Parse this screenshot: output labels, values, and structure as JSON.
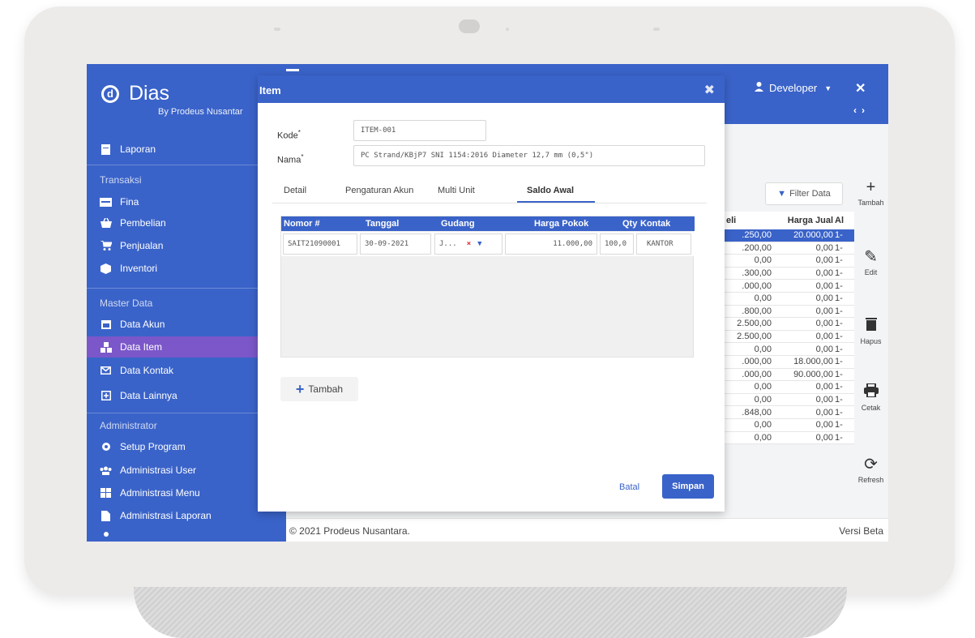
{
  "brand": {
    "name": "Dias",
    "subtitle": "By Prodeus Nusantar"
  },
  "sidebar": {
    "report_item": "Laporan",
    "sections": {
      "transaksi": "Transaksi",
      "master": "Master Data",
      "admin": "Administrator"
    },
    "transaksi_items": [
      "Fina",
      "Pembelian",
      "Penjualan",
      "Inventori"
    ],
    "master_items": [
      "Data Akun",
      "Data Item",
      "Data Kontak",
      "Data Lainnya"
    ],
    "admin_items": [
      "Setup Program",
      "Administrasi User",
      "Administrasi Menu",
      "Administrasi Laporan"
    ],
    "active_item": "Data Item"
  },
  "topbar": {
    "user": "Developer"
  },
  "toolbar": {
    "filter_label": "Filter Data",
    "add": "Tambah",
    "edit": "Edit",
    "delete": "Hapus",
    "print": "Cetak",
    "refresh": "Refresh"
  },
  "background_table": {
    "headers": [
      "eli",
      "Harga Jual",
      "Al"
    ],
    "rows": [
      [
        ".250,00",
        "20.000,00",
        "1-"
      ],
      [
        ".200,00",
        "0,00",
        "1-"
      ],
      [
        "0,00",
        "0,00",
        "1-"
      ],
      [
        ".300,00",
        "0,00",
        "1-"
      ],
      [
        ".000,00",
        "0,00",
        "1-"
      ],
      [
        "0,00",
        "0,00",
        "1-"
      ],
      [
        ".800,00",
        "0,00",
        "1-"
      ],
      [
        "2.500,00",
        "0,00",
        "1-"
      ],
      [
        "2.500,00",
        "0,00",
        "1-"
      ],
      [
        "0,00",
        "0,00",
        "1-"
      ],
      [
        ".000,00",
        "18.000,00",
        "1-"
      ],
      [
        ".000,00",
        "90.000,00",
        "1-"
      ],
      [
        "0,00",
        "0,00",
        "1-"
      ],
      [
        "0,00",
        "0,00",
        "1-"
      ],
      [
        ".848,00",
        "0,00",
        "1-"
      ],
      [
        "0,00",
        "0,00",
        "1-"
      ],
      [
        "0,00",
        "0,00",
        "1-"
      ]
    ]
  },
  "footer": {
    "copyright": "© 2021 Prodeus Nusantara.",
    "version": "Versi Beta"
  },
  "modal": {
    "title": "Item",
    "kode_label": "Kode",
    "kode_value": "ITEM-001",
    "nama_label": "Nama",
    "nama_value": "PC Strand/KBjP7 SNI 1154:2016 Diameter 12,7 mm (0,5\")",
    "tabs": [
      "Detail",
      "Pengaturan Akun",
      "Multi Unit",
      "Saldo Awal"
    ],
    "active_tab": "Saldo Awal",
    "grid": {
      "headers": [
        "Nomor #",
        "Tanggal",
        "Gudang",
        "Harga Pokok",
        "Qty",
        "Kontak"
      ],
      "row": {
        "nomor": "SAIT21090001",
        "tanggal": "30-09-2021",
        "gudang": "J...",
        "harga_pokok": "11.000,00",
        "qty": "100,0",
        "kontak": "KANTOR"
      }
    },
    "add_label": "Tambah",
    "cancel_label": "Batal",
    "save_label": "Simpan"
  }
}
